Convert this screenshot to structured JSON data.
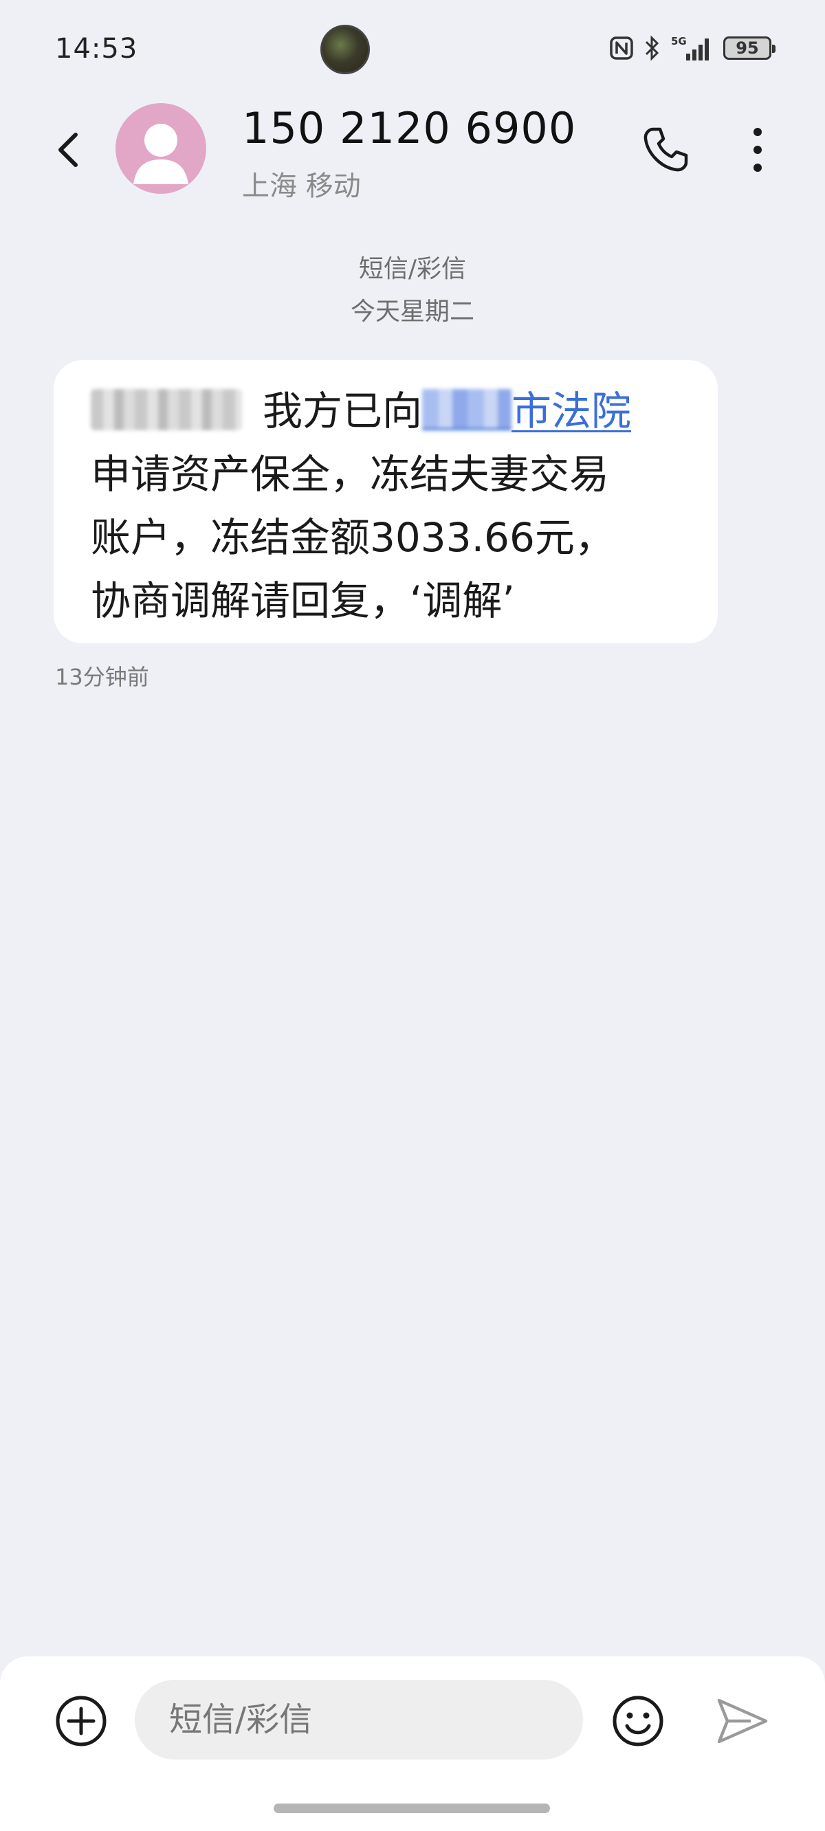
{
  "status_bar": {
    "time": "14:53",
    "network": "5G",
    "battery": "95"
  },
  "header": {
    "back_icon": "chevron-left-icon",
    "contact_number": "150 2120 6900",
    "contact_location": "上海 移动",
    "call_icon": "phone-icon",
    "more_icon": "more-vertical-icon"
  },
  "conversation": {
    "type_label": "短信/彩信",
    "date_label": "今天星期二",
    "message": {
      "line1_text": "我方已向",
      "line1_link": "市法院",
      "line2": "申请资产保全，冻结夫妻交易",
      "line3": "账户，冻结金额3033.66元，",
      "line4": "协商调解请回复，‘调解’",
      "time": "13分钟前"
    }
  },
  "input_bar": {
    "add_icon": "plus-circle-icon",
    "placeholder": "短信/彩信",
    "value": "",
    "emoji_icon": "smiley-icon",
    "send_icon": "send-icon"
  },
  "colors": {
    "background": "#eff0f6",
    "link": "#3a6fd8",
    "avatar": "#e2a6c7"
  }
}
